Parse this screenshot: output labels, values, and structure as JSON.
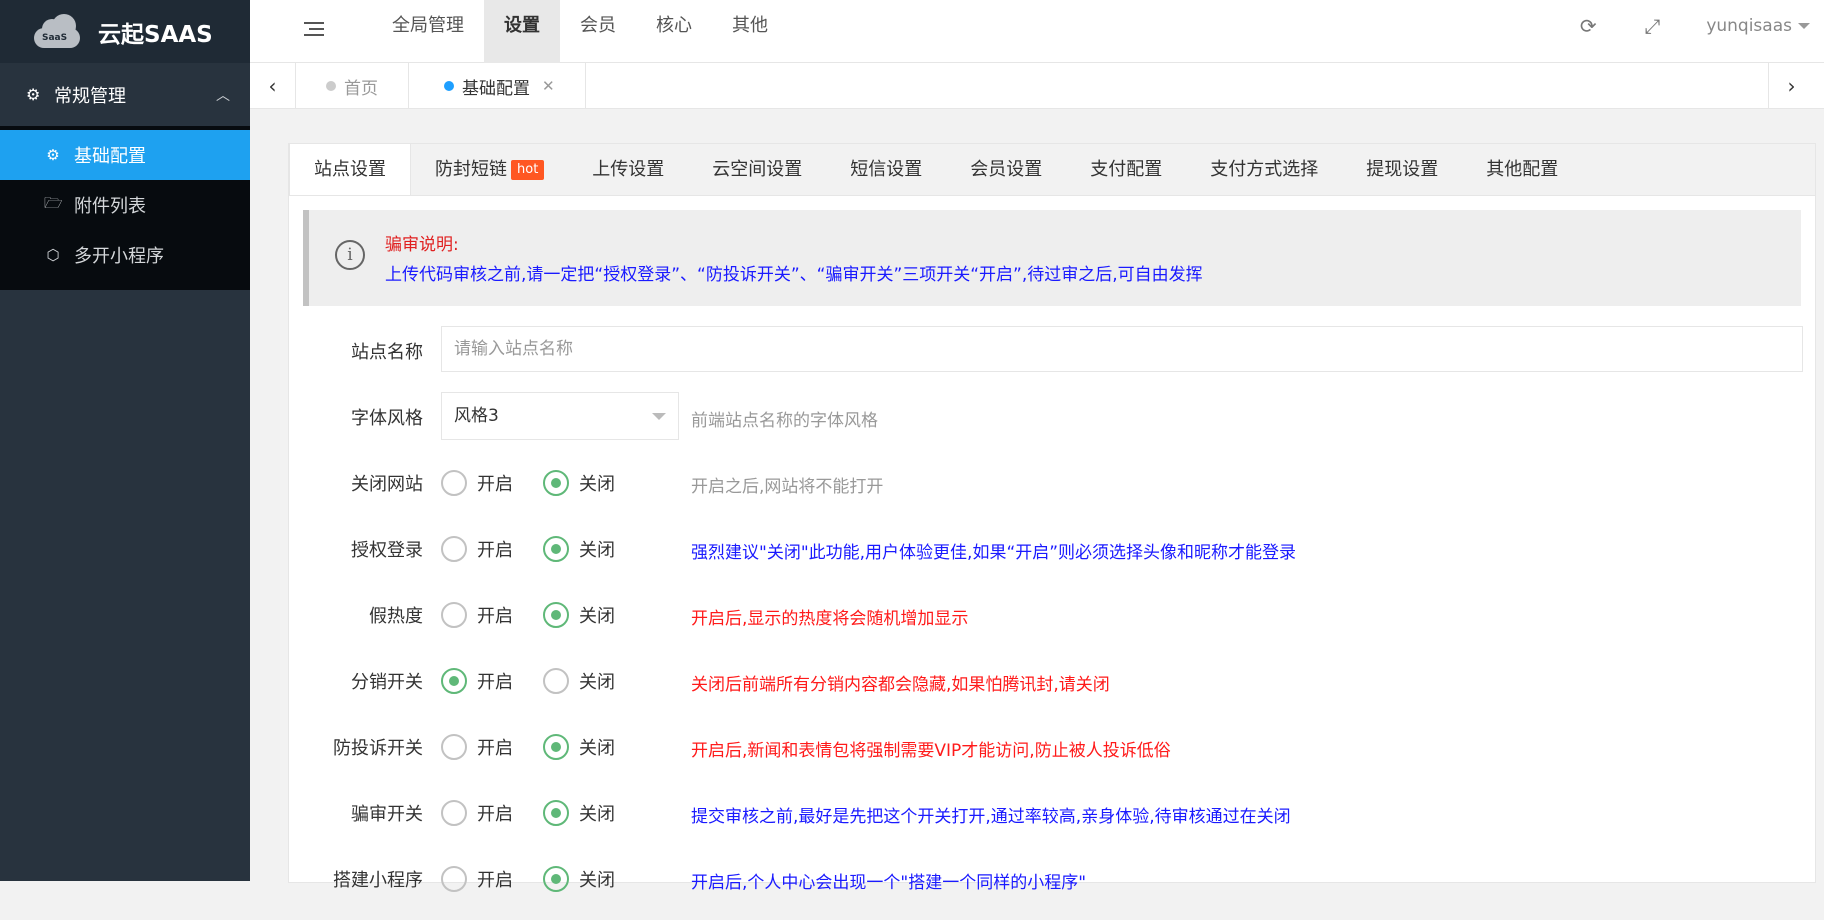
{
  "sidebar": {
    "logo_badge": "SaaS",
    "brand": "云起SAAS",
    "group_label": "常规管理",
    "items": [
      {
        "label": "基础配置",
        "active": true
      },
      {
        "label": "附件列表",
        "active": false
      },
      {
        "label": "多开小程序",
        "active": false
      }
    ]
  },
  "header": {
    "nav": [
      "全局管理",
      "设置",
      "会员",
      "核心",
      "其他"
    ],
    "active_nav": "设置",
    "username": "yunqisaas"
  },
  "page_tabs": {
    "home": "首页",
    "current": "基础配置"
  },
  "subtabs": {
    "items": [
      "站点设置",
      "防封短链",
      "上传设置",
      "云空间设置",
      "短信设置",
      "会员设置",
      "支付配置",
      "支付方式选择",
      "提现设置",
      "其他配置"
    ],
    "hot_badge": "hot",
    "active": "站点设置"
  },
  "notice": {
    "title": "骗审说明:",
    "body": "上传代码审核之前,请一定把“授权登录”、“防投诉开关”、“骗审开关”三项开关“开启”,待过审之后,可自由发挥"
  },
  "form": {
    "site_name": {
      "label": "站点名称",
      "placeholder": "请输入站点名称"
    },
    "font_style": {
      "label": "字体风格",
      "value": "风格3",
      "hint": "前端站点名称的字体风格"
    },
    "radio_on": "开启",
    "radio_off": "关闭",
    "rows": [
      {
        "label": "关闭网站",
        "selected": "off",
        "hint": "开启之后,网站将不能打开",
        "hint_color": "gray"
      },
      {
        "label": "授权登录",
        "selected": "off",
        "hint": "强烈建议\"关闭\"此功能,用户体验更佳,如果“开启”则必须选择头像和昵称才能登录",
        "hint_color": "blue"
      },
      {
        "label": "假热度",
        "selected": "off",
        "hint": "开启后,显示的热度将会随机增加显示",
        "hint_color": "red"
      },
      {
        "label": "分销开关",
        "selected": "on",
        "hint": "关闭后前端所有分销内容都会隐藏,如果怕腾讯封,请关闭",
        "hint_color": "red"
      },
      {
        "label": "防投诉开关",
        "selected": "off",
        "hint": "开启后,新闻和表情包将强制需要VIP才能访问,防止被人投诉低俗",
        "hint_color": "red"
      },
      {
        "label": "骗审开关",
        "selected": "off",
        "hint": "提交审核之前,最好是先把这个开关打开,通过率较高,亲身体验,待审核通过在关闭",
        "hint_color": "blue"
      },
      {
        "label": "搭建小程序",
        "selected": "off",
        "hint": "开启后,个人中心会出现一个\"搭建一个同样的小程序\"",
        "hint_color": "blue"
      }
    ]
  },
  "colors": {
    "sidebar_bg": "#28333e",
    "active_blue": "#1ea1f0",
    "radio_green": "#5fb878",
    "hot_orange": "#ff5722"
  }
}
